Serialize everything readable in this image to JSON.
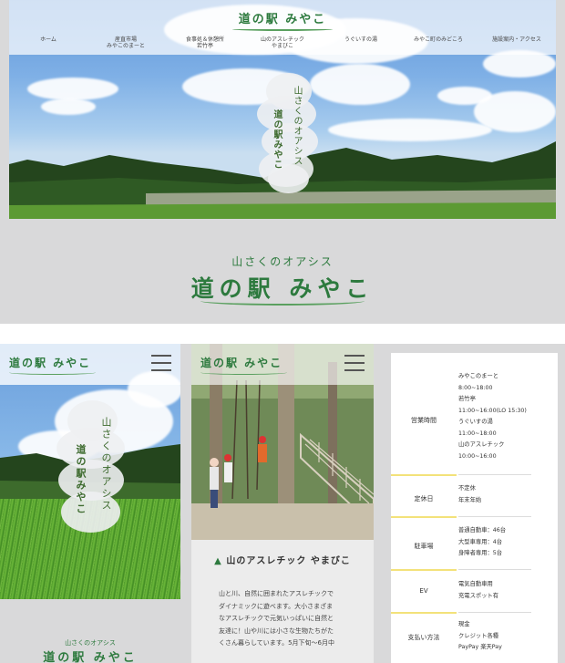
{
  "desktop": {
    "logo": "道の駅 みやこ",
    "nav": [
      [
        "ホーム"
      ],
      [
        "産直市場",
        "みやこのまーと"
      ],
      [
        "食事処＆休憩所",
        "若竹亭"
      ],
      [
        "山のアスレチック",
        "やまびこ"
      ],
      [
        "うぐいすの湯"
      ],
      [
        "みやこ町のみどころ"
      ],
      [
        "施設案内・アクセス"
      ]
    ],
    "bubble_col1": "山さくのオアシス",
    "bubble_col2": "道の駅みやこ"
  },
  "main_logo": {
    "sub": "山さくのオアシス",
    "title": "道の駅 みやこ"
  },
  "mobile1": {
    "logo": "道の駅 みやこ",
    "bubble_col1": "山さくのオアシス",
    "bubble_col2": "道の駅みやこ",
    "footer_sub": "山さくのオアシス",
    "footer_title": "道の駅 みやこ"
  },
  "mobile2": {
    "logo": "道の駅 みやこ",
    "section_title": "山のアスレチック やまびこ",
    "body_lines": [
      "山と川、自然に囲まれたアスレチックで",
      "ダイナミックに遊べます。大小さまざま",
      "なアスレチックで元気いっぱいに自然と",
      "友達に！山や川には小さな生物たちがた",
      "くさん暮らしています。5月下旬〜6月中"
    ]
  },
  "mobile3": {
    "rows": [
      {
        "label": "営業時間",
        "values": [
          "みやこのまーと",
          "8:00~18:00",
          "若竹亭",
          "11:00~16:00(LO 15:30)",
          "うぐいすの湯",
          "11:00~18:00",
          "山のアスレチック",
          "10:00~16:00"
        ]
      },
      {
        "label": "定休日",
        "values": [
          "不定休",
          "年末年始"
        ]
      },
      {
        "label": "駐車場",
        "values": [
          "普通自動車：46台",
          "大型車専用：4台",
          "身障者専用：5台"
        ]
      },
      {
        "label": "EV",
        "values": [
          "電気自動車用",
          "充電スポット有"
        ]
      },
      {
        "label": "支払い方法",
        "values": [
          "現金",
          "クレジット各種",
          "PayPay 楽天Pay"
        ]
      }
    ]
  },
  "colors": {
    "brand_green": "#2d7a3e",
    "sky": "#7fb0e6",
    "highlight": "#f3e27a",
    "page_bg": "#d9d9da"
  }
}
